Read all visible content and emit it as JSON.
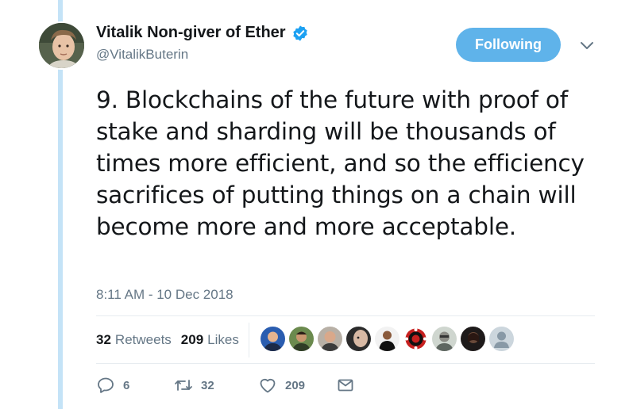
{
  "tweet": {
    "author": {
      "display_name": "Vitalik Non-giver of Ether",
      "handle": "@VitalikButerin",
      "verified": true
    },
    "follow_button_label": "Following",
    "text": "9. Blockchains of the future with proof of stake and sharding will be thousands of times more efficient, and so the efficiency sacrifices of putting things on a chain will become more and more acceptable.",
    "timestamp": "8:11 AM - 10 Dec 2018",
    "stats": {
      "retweets_count": "32",
      "retweets_label": "Retweets",
      "likes_count": "209",
      "likes_label": "Likes"
    },
    "actions": {
      "reply_count": "6",
      "retweet_count": "32",
      "like_count": "209"
    }
  },
  "colors": {
    "accent": "#5fb3ea",
    "thread_line": "#c4e3f7",
    "muted_text": "#657786",
    "primary_text": "#14171a",
    "verified": "#1da1f2"
  },
  "icons": {
    "reply": "reply-icon",
    "retweet": "retweet-icon",
    "like": "heart-icon",
    "dm": "envelope-icon",
    "caret": "chevron-down-icon",
    "verified": "verified-badge-icon"
  }
}
